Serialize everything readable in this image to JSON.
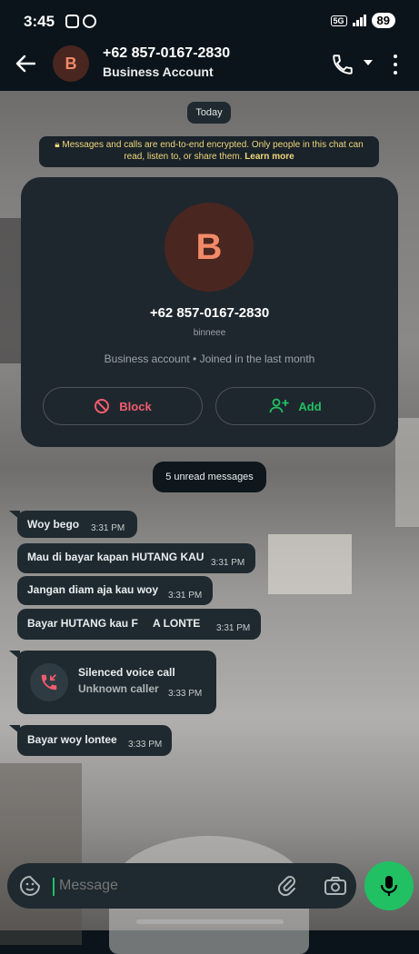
{
  "status_bar": {
    "time": "3:45",
    "network": "5G",
    "battery": "89"
  },
  "header": {
    "avatar_letter": "B",
    "phone": "+62 857-0167-2830",
    "subtitle": "Business Account"
  },
  "date_chip": "Today",
  "encryption_notice": {
    "text": "Messages and calls are end-to-end encrypted. Only people in this chat can read, listen to, or share them.",
    "link": "Learn more"
  },
  "profile_card": {
    "avatar_letter": "B",
    "phone": "+62 857-0167-2830",
    "username": "binneee",
    "info": "Business account • Joined in the last month",
    "block_label": "Block",
    "add_label": "Add"
  },
  "unread_chip": "5 unread messages",
  "messages": [
    {
      "text": "Woy bego",
      "time": "3:31 PM"
    },
    {
      "text": "Mau di bayar kapan HUTANG KAU",
      "time": "3:31 PM"
    },
    {
      "text": "Jangan diam aja kau woy",
      "time": "3:31 PM"
    },
    {
      "text": "Bayar HUTANG kau F     A LONTE",
      "time": "3:31 PM"
    },
    {
      "call_title": "Silenced voice call",
      "call_sub": "Unknown caller",
      "time": "3:33 PM"
    },
    {
      "text": "Bayar woy lontee",
      "time": "3:33 PM"
    }
  ],
  "composer": {
    "placeholder": "Message"
  },
  "colors": {
    "accent": "#21c063",
    "danger": "#f15c6d",
    "bubble": "#1f2a30",
    "header": "#0b141a"
  }
}
